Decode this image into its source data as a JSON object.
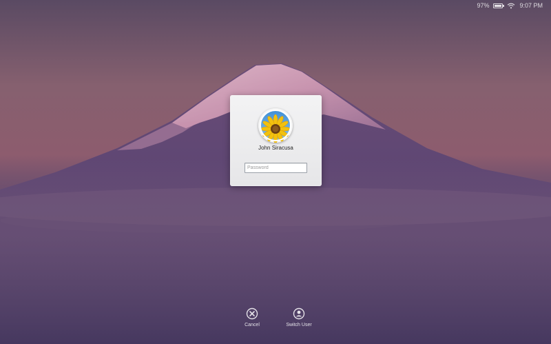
{
  "status_bar": {
    "battery_percent_text": "97%",
    "battery_level": 0.97,
    "time": "9:07 PM"
  },
  "login": {
    "user_name": "John Siracusa",
    "password_placeholder": "Password",
    "password_value": ""
  },
  "bottom_actions": {
    "cancel_label": "Cancel",
    "switch_user_label": "Switch User"
  },
  "icons": {
    "battery": "battery-icon",
    "charging": "charging-bolt-icon",
    "wifi": "wifi-icon",
    "avatar": "sunflower-avatar-icon",
    "cancel": "cancel-circle-icon",
    "switch_user": "user-circle-icon"
  },
  "colors": {
    "panel_bg": "#ececee",
    "accent_text": "#ffffff",
    "input_border": "#9aa0a8"
  }
}
